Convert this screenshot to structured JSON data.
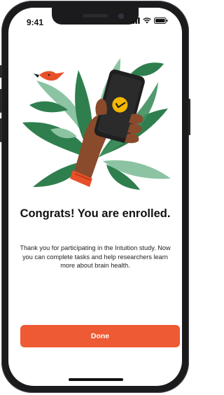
{
  "status_bar": {
    "time": "9:41",
    "icons": [
      "signal-icon",
      "wifi-icon",
      "battery-icon"
    ]
  },
  "illustration": {
    "description_icon": "hand-holding-phone-check-icon",
    "colors": {
      "leaf_green": "#2f7f4e",
      "leaf_light": "#8cc4a3",
      "skin": "#8a4b2c",
      "phone": "#1f1f1f",
      "check_circle": "#f5b700",
      "sleeve": "#e8502a",
      "bird": "#e8502a"
    }
  },
  "main": {
    "title": "Congrats! You are enrolled.",
    "body": "Thank you for participating in the Intuition study. Now you can complete tasks and help researchers learn more about brain health.",
    "done_label": "Done"
  },
  "colors": {
    "accent": "#ee5a33",
    "text": "#111111"
  }
}
